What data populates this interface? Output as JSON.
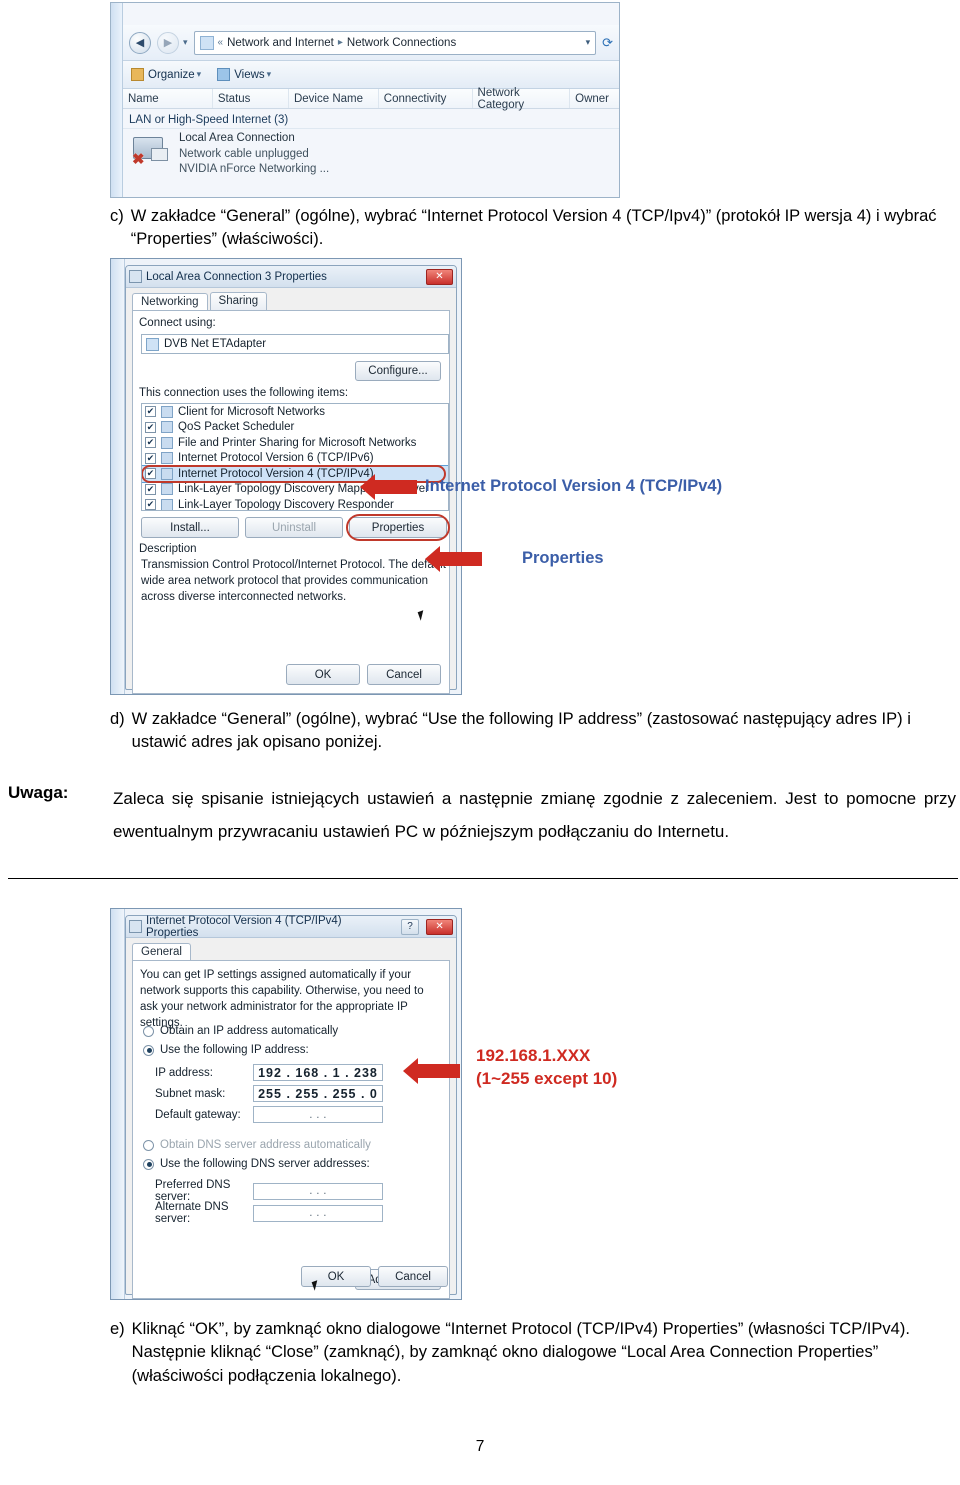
{
  "explorer": {
    "address": {
      "back_icon": "back-arrow-icon",
      "forward_icon": "forward-arrow-icon",
      "crumb1": "Network and Internet",
      "crumb2": "Network Connections",
      "chevron": "▾",
      "refresh_icon": "refresh-icon",
      "sep": "▸",
      "double_sep": "«"
    },
    "toolbar": {
      "organize": "Organize",
      "views": "Views",
      "caret": "▾"
    },
    "columns": [
      "Name",
      "Status",
      "Device Name",
      "Connectivity",
      "Network Category",
      "Owner"
    ],
    "group_header": "LAN or High-Speed Internet (3)",
    "item": {
      "name": "Local Area Connection",
      "status": "Network cable unplugged",
      "device": "NVIDIA nForce Networking ..."
    }
  },
  "step_c": {
    "marker": "c)",
    "text": "W zakładce “General” (ogólne), wybrać “Internet Protocol Version 4 (TCP/Ipv4)” (protokół IP wersja 4) i wybrać “Properties” (właściwości)."
  },
  "lan_dialog": {
    "title": "Local Area Connection 3 Properties",
    "close_label": "✕",
    "tabs": [
      "Networking",
      "Sharing"
    ],
    "active_tab": "Networking",
    "connect_using_label": "Connect using:",
    "adapter": "DVB Net ETAdapter",
    "configure_button": "Configure...",
    "items_label": "This connection uses the following items:",
    "items": [
      {
        "label": "Client for Microsoft Networks",
        "checked": true,
        "selected": false
      },
      {
        "label": "QoS Packet Scheduler",
        "checked": true,
        "selected": false
      },
      {
        "label": "File and Printer Sharing for Microsoft Networks",
        "checked": true,
        "selected": false
      },
      {
        "label": "Internet Protocol Version 6 (TCP/IPv6)",
        "checked": true,
        "selected": false
      },
      {
        "label": "Internet Protocol Version 4 (TCP/IPv4)",
        "checked": true,
        "selected": true
      },
      {
        "label": "Link-Layer Topology Discovery Mapper I/O Driver",
        "checked": true,
        "selected": false
      },
      {
        "label": "Link-Layer Topology Discovery Responder",
        "checked": true,
        "selected": false
      }
    ],
    "buttons": {
      "install": "Install...",
      "uninstall": "Uninstall",
      "properties": "Properties"
    },
    "description_label": "Description",
    "description": "Transmission Control Protocol/Internet Protocol. The default wide area network protocol that provides communication across diverse interconnected networks.",
    "ok": "OK",
    "cancel": "Cancel",
    "callout_protocol": "Internet Protocol Version 4 (TCP/IPv4)",
    "callout_properties": "Properties"
  },
  "step_d": {
    "marker": "d)",
    "text": "W zakładce “General” (ogólne), wybrać “Use the following IP address” (zastosować następujący adres IP) i ustawić adres jak opisano poniżej."
  },
  "note": {
    "label": "Uwaga:",
    "text": "Zaleca się spisanie istniejących ustawień a następnie zmianę zgodnie z zaleceniem. Jest to pomocne przy ewentualnym przywracaniu ustawień PC w późniejszym podłączaniu do Internetu."
  },
  "ip_dialog": {
    "title": "Internet Protocol Version 4 (TCP/IPv4) Properties",
    "help_label": "?",
    "close_label": "✕",
    "tab": "General",
    "intro": "You can get IP settings assigned automatically if your network supports this capability. Otherwise, you need to ask your network administrator for the appropriate IP settings.",
    "opt_auto_ip": "Obtain an IP address automatically",
    "opt_manual_ip": "Use the following IP address:",
    "fields": [
      {
        "label": "IP address:",
        "value": "192 . 168 . 1 . 238"
      },
      {
        "label": "Subnet mask:",
        "value": "255 . 255 . 255 . 0"
      },
      {
        "label": "Default gateway:",
        "value": ".   .   ."
      }
    ],
    "opt_auto_dns": "Obtain DNS server address automatically",
    "opt_manual_dns": "Use the following DNS server addresses:",
    "dns_fields": [
      {
        "label": "Preferred DNS server:",
        "value": ".   .   ."
      },
      {
        "label": "Alternate DNS server:",
        "value": ".   .   ."
      }
    ],
    "advanced": "Advanced...",
    "ok": "OK",
    "cancel": "Cancel",
    "callout_line1": "192.168.1.XXX",
    "callout_line2": "(1~255 except 10)"
  },
  "step_e": {
    "marker": "e)",
    "text": "Kliknąć “OK”, by zamknąć okno dialogowe “Internet Protocol (TCP/IPv4) Properties” (własności TCP/IPv4). Następnie kliknąć “Close” (zamknąć), by zamknąć okno dialogowe “Local Area Connection Properties” (właściwości podłączenia lokalnego)."
  },
  "page_number": "7"
}
